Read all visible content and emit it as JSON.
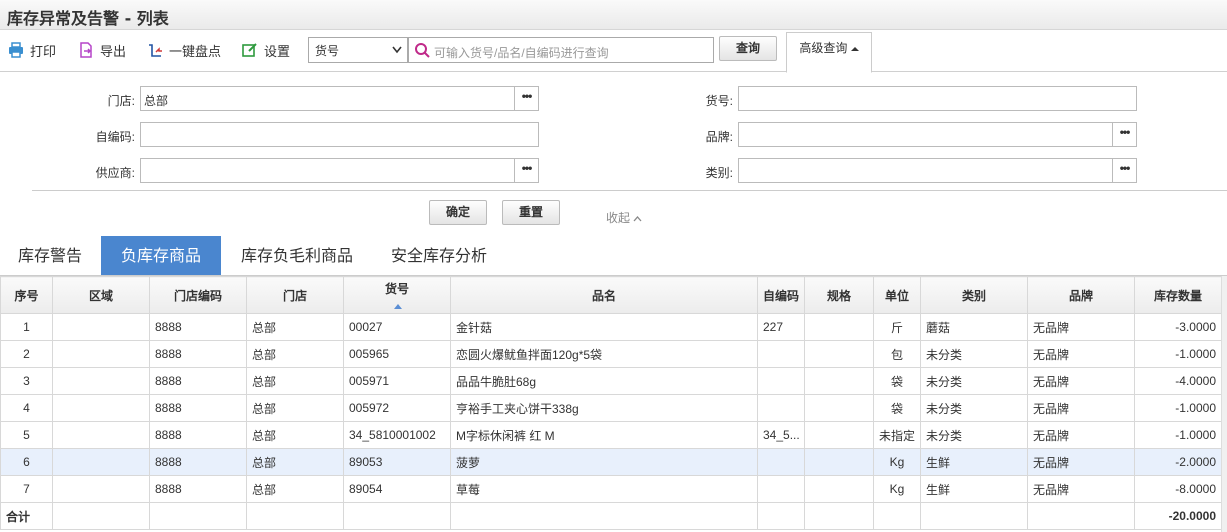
{
  "title": "库存异常及告警 - 列表",
  "toolbar": {
    "print": "打印",
    "export": "导出",
    "inventory": "一键盘点",
    "settings": "设置",
    "field_select": "货号",
    "search_placeholder": "可输入货号/品名/自编码进行查询",
    "query": "查询",
    "advanced": "高级查询"
  },
  "filters": {
    "store_label": "门店:",
    "store_value": "总部",
    "code_label": "自编码:",
    "supplier_label": "供应商:",
    "sku_label": "货号:",
    "brand_label": "品牌:",
    "category_label": "类别:",
    "confirm": "确定",
    "reset": "重置",
    "collapse": "收起"
  },
  "tabs": [
    "库存警告",
    "负库存商品",
    "库存负毛利商品",
    "安全库存分析"
  ],
  "active_tab": 1,
  "table": {
    "columns": [
      "序号",
      "区域",
      "门店编码",
      "门店",
      "货号",
      "品名",
      "自编码",
      "规格",
      "单位",
      "类别",
      "品牌",
      "库存数量"
    ],
    "rows": [
      [
        "1",
        "",
        "8888",
        "总部",
        "00027",
        "金针菇",
        "227",
        "",
        "斤",
        "蘑菇",
        "无品牌",
        "-3.0000"
      ],
      [
        "2",
        "",
        "8888",
        "总部",
        "005965",
        "恋圆火爆鱿鱼拌面120g*5袋",
        "",
        "",
        "包",
        "未分类",
        "无品牌",
        "-1.0000"
      ],
      [
        "3",
        "",
        "8888",
        "总部",
        "005971",
        "品品牛脆肚68g",
        "",
        "",
        "袋",
        "未分类",
        "无品牌",
        "-4.0000"
      ],
      [
        "4",
        "",
        "8888",
        "总部",
        "005972",
        "亨裕手工夹心饼干338g",
        "",
        "",
        "袋",
        "未分类",
        "无品牌",
        "-1.0000"
      ],
      [
        "5",
        "",
        "8888",
        "总部",
        "34_5810001002",
        "M字标休闲裤 红 M",
        "34_5...",
        "",
        "未指定",
        "未分类",
        "无品牌",
        "-1.0000"
      ],
      [
        "6",
        "",
        "8888",
        "总部",
        "89053",
        "菠萝",
        "",
        "",
        "Kg",
        "生鲜",
        "无品牌",
        "-2.0000"
      ],
      [
        "7",
        "",
        "8888",
        "总部",
        "89054",
        "草莓",
        "",
        "",
        "Kg",
        "生鲜",
        "无品牌",
        "-8.0000"
      ]
    ],
    "selected_row": 5,
    "total_label": "合计",
    "total_value": "-20.0000"
  }
}
